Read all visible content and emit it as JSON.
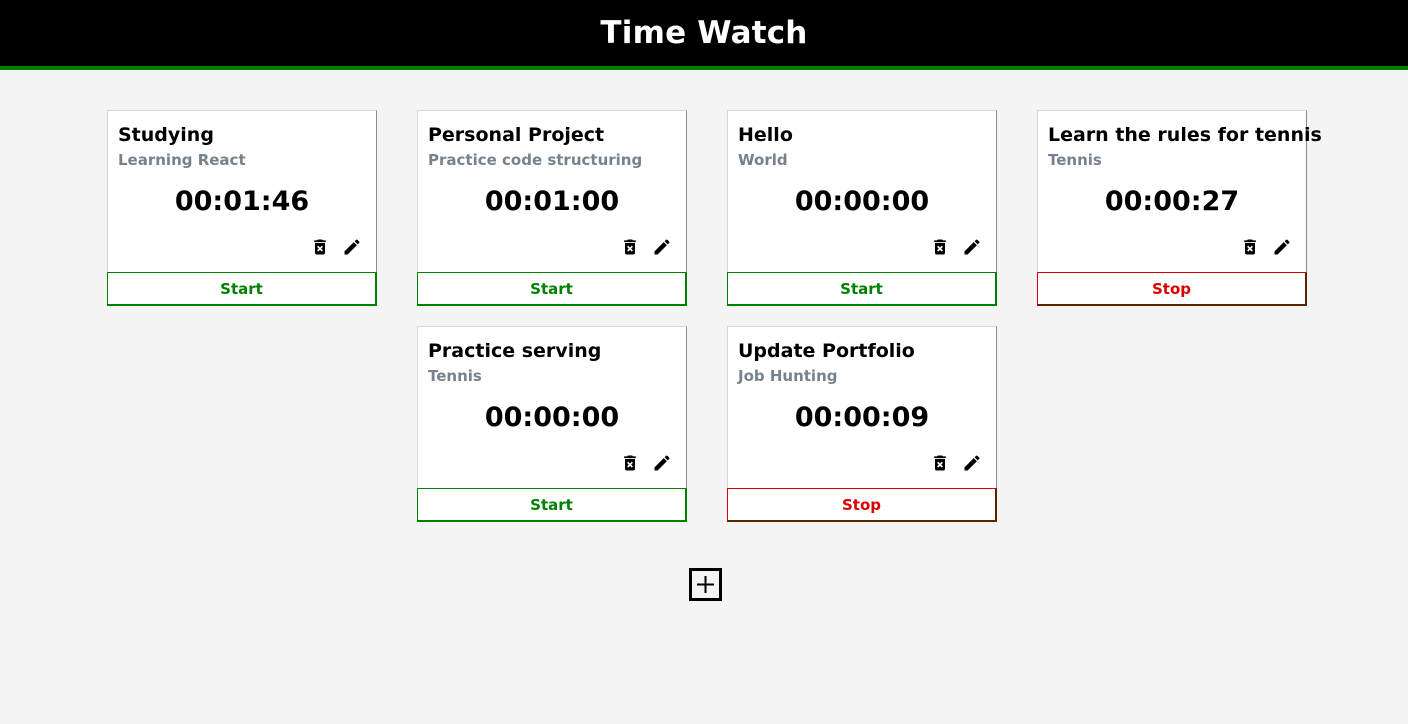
{
  "app": {
    "title": "Time Watch"
  },
  "colors": {
    "header_background": "#000000",
    "header_accent": "#008000",
    "start_color": "#008000",
    "stop_color": "#db0000",
    "project_text": "#77828f",
    "page_background": "#f4f4f4"
  },
  "icons": {
    "delete": "trash-icon",
    "edit": "pencil-icon",
    "add": "plus-square-icon"
  },
  "timers": [
    {
      "title": "Studying",
      "project": "Learning React",
      "elapsed": "00:01:46",
      "action": "Start",
      "running": false
    },
    {
      "title": "Personal Project",
      "project": "Practice code structuring",
      "elapsed": "00:01:00",
      "action": "Start",
      "running": false
    },
    {
      "title": "Hello",
      "project": "World",
      "elapsed": "00:00:00",
      "action": "Start",
      "running": false
    },
    {
      "title": "Learn the rules for tennis",
      "project": "Tennis",
      "elapsed": "00:00:27",
      "action": "Stop",
      "running": true
    },
    {
      "title": "Practice serving",
      "project": "Tennis",
      "elapsed": "00:00:00",
      "action": "Start",
      "running": false
    },
    {
      "title": "Update Portfolio",
      "project": "Job Hunting",
      "elapsed": "00:00:09",
      "action": "Stop",
      "running": true
    }
  ]
}
